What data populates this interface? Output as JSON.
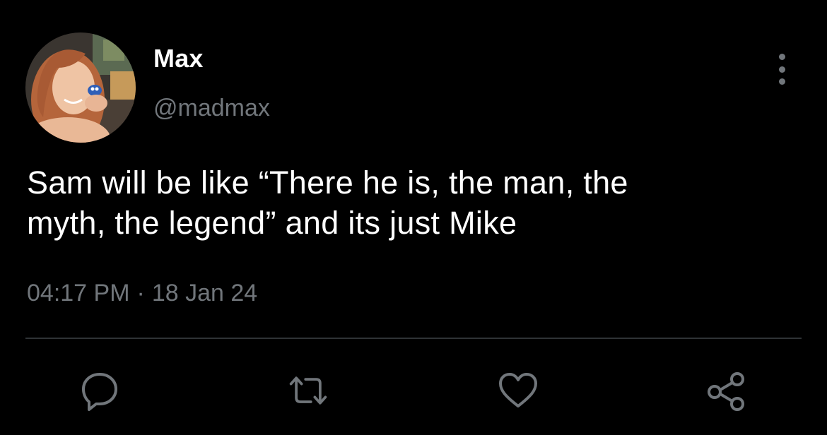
{
  "tweet": {
    "display_name": "Max",
    "handle": "@madmax",
    "text_lines": [
      "Sam will be like “There he is, the man, the",
      "myth, the legend” and its just Mike"
    ],
    "time": "04:17 PM",
    "separator": "·",
    "date": "18 Jan 24"
  },
  "icons": {
    "more": "more-vertical-icon",
    "reply": "reply-bubble-icon",
    "retweet": "retweet-icon",
    "like": "heart-icon",
    "share": "share-icon"
  },
  "colors": {
    "background": "#000000",
    "primary_text": "#ffffff",
    "secondary_text": "#71767b",
    "divider": "#2f3336"
  }
}
